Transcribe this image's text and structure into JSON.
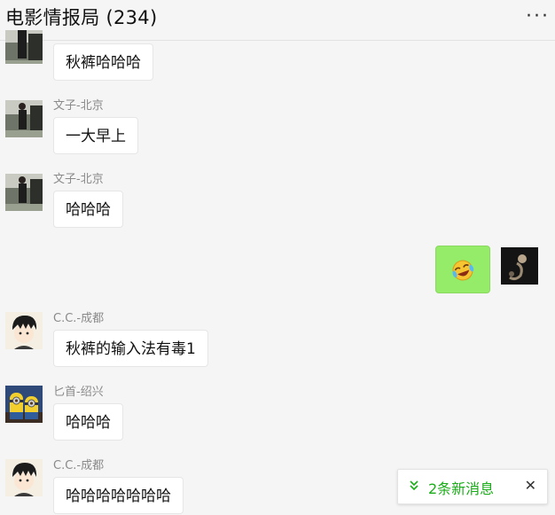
{
  "header": {
    "title": "电影情报局 (234)",
    "more_label": "···"
  },
  "messages": [
    {
      "sender": "",
      "text": "秋裤哈哈哈"
    },
    {
      "sender": "文子-北京",
      "text": "一大早上"
    },
    {
      "sender": "文子-北京",
      "text": "哈哈哈"
    },
    {
      "sender": "",
      "text": "",
      "emoji": "laughing-tears-emoji"
    },
    {
      "sender": "C.C.-成都",
      "text": "秋裤的输入法有毒1"
    },
    {
      "sender": "匕首-绍兴",
      "text": "哈哈哈"
    },
    {
      "sender": "C.C.-成都",
      "text": "哈哈哈哈哈哈哈"
    }
  ],
  "toast": {
    "chevron_icon": "double-chevron-down-icon",
    "text": "2条新消息",
    "close_label": "✕"
  },
  "colors": {
    "background": "#f5f5f5",
    "own_bubble": "#95ec69",
    "accent": "#1aad19"
  }
}
